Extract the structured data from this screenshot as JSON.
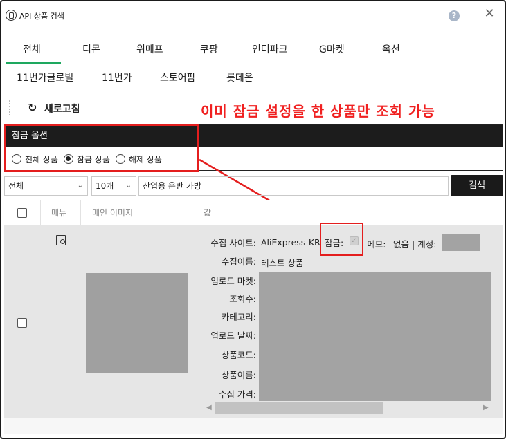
{
  "window": {
    "title": "API 상품 검색",
    "help_icon": "help-icon",
    "close_icon": "close-icon",
    "close_glyph": "✕",
    "help_glyph": "?"
  },
  "tabs_row1": [
    "전체",
    "티몬",
    "위메프",
    "쿠팡",
    "인터파크",
    "G마켓",
    "옥션"
  ],
  "tabs_row2": [
    "11번가글로벌",
    "11번가",
    "스토어팜",
    "롯데온"
  ],
  "active_tab": "전체",
  "toolbar": {
    "refresh_label": "새로고침",
    "refresh_icon": "refresh-icon",
    "refresh_glyph": "↻"
  },
  "annotation": "이미 잠금 설정을 한 상품만 조회 가능",
  "lock_options": {
    "title": "잠금 옵션",
    "options": [
      "전체 상품",
      "잠금 상품",
      "해제 상품"
    ],
    "selected": "잠금 상품"
  },
  "search": {
    "filter_value": "전체",
    "count_value": "10개",
    "query": "산업용 운반 가방",
    "button_label": "검색"
  },
  "table": {
    "headers": {
      "menu": "메뉴",
      "main_image": "메인 이미지",
      "value": "값"
    }
  },
  "row": {
    "labels": {
      "site": "수집 사이트:",
      "name": "수집이름:",
      "upload_market": "업로드 마켓:",
      "views": "조회수:",
      "category": "카테고리:",
      "upload_date": "업로드 날짜:",
      "product_code": "상품코드:",
      "product_name": "상품이름:",
      "price": "수집 가격:"
    },
    "site_value": "AliExpress-KR",
    "lock_label": "잠금:",
    "memo_label": "메모:",
    "memo_value": "없음",
    "account_label": "계정:",
    "name_value": "테스트 상품",
    "locked": true
  },
  "colors": {
    "accent_green": "#1ea85f",
    "annotation_red": "#f02020",
    "header_dark": "#1c1c1c"
  }
}
